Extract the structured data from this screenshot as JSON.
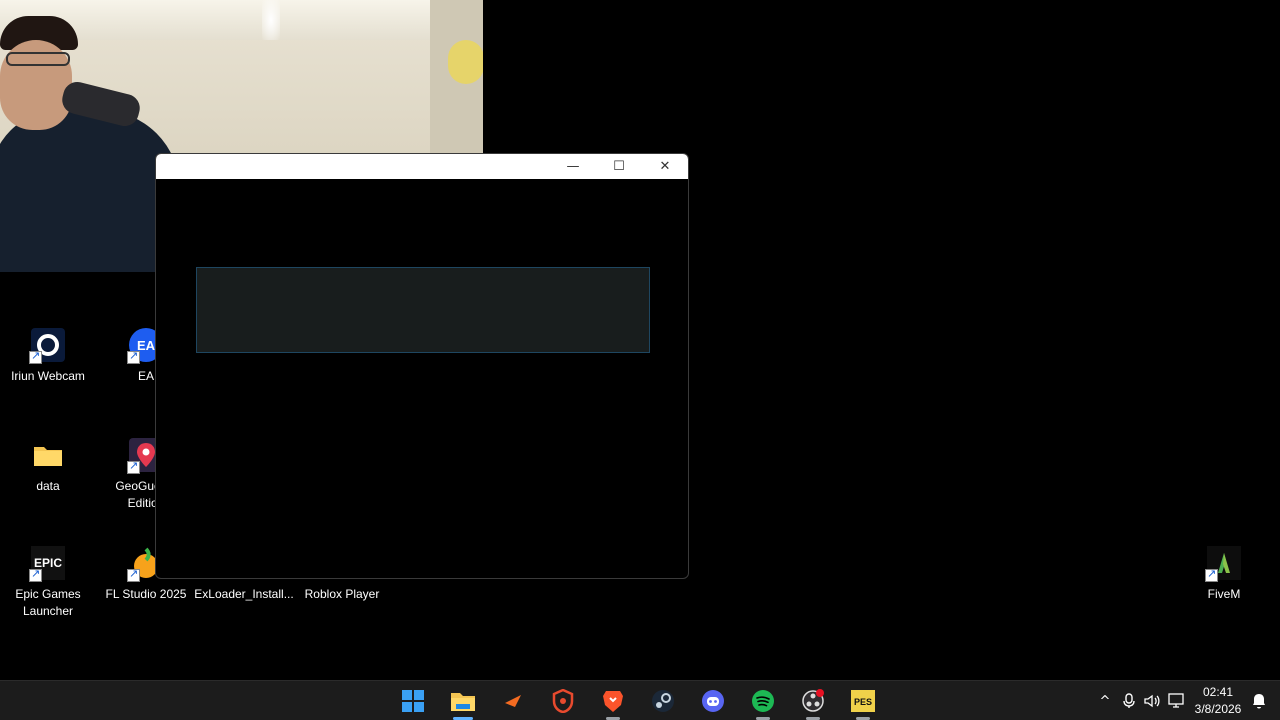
{
  "desktop": {
    "icons": [
      {
        "label": "Iriun Webcam"
      },
      {
        "label": "EA"
      },
      {
        "label": "data"
      },
      {
        "label": "GeoGuessr Edition"
      },
      {
        "label": "Epic Games Launcher"
      },
      {
        "label": "FL Studio 2025"
      },
      {
        "label": "ExLoader_Install..."
      },
      {
        "label": "Roblox Player"
      },
      {
        "label": "FiveM"
      }
    ]
  },
  "window": {
    "minimize_glyph": "—",
    "maximize_glyph": "☐",
    "close_glyph": "✕"
  },
  "taskbar": {
    "apps": [
      {
        "name": "start",
        "icon": "windows-logo-icon"
      },
      {
        "name": "file-explorer",
        "icon": "folder-icon"
      },
      {
        "name": "app-arrow",
        "icon": "orange-arrow-icon"
      },
      {
        "name": "shield-app",
        "icon": "shield-icon"
      },
      {
        "name": "brave",
        "icon": "brave-lion-icon"
      },
      {
        "name": "steam",
        "icon": "steam-icon"
      },
      {
        "name": "discord",
        "icon": "discord-icon"
      },
      {
        "name": "spotify",
        "icon": "spotify-icon"
      },
      {
        "name": "obs",
        "icon": "obs-icon"
      },
      {
        "name": "pes",
        "icon": "pes-icon"
      }
    ],
    "tray": {
      "chevron": "^",
      "time": "02:41",
      "date": "3/8/2026"
    }
  },
  "colors": {
    "taskbar_bg": "#1c1c1c",
    "accent_blue": "#1e88e5",
    "spotify_green": "#1db954",
    "discord_blurple": "#5865f2",
    "brave_orange": "#fb542b"
  }
}
